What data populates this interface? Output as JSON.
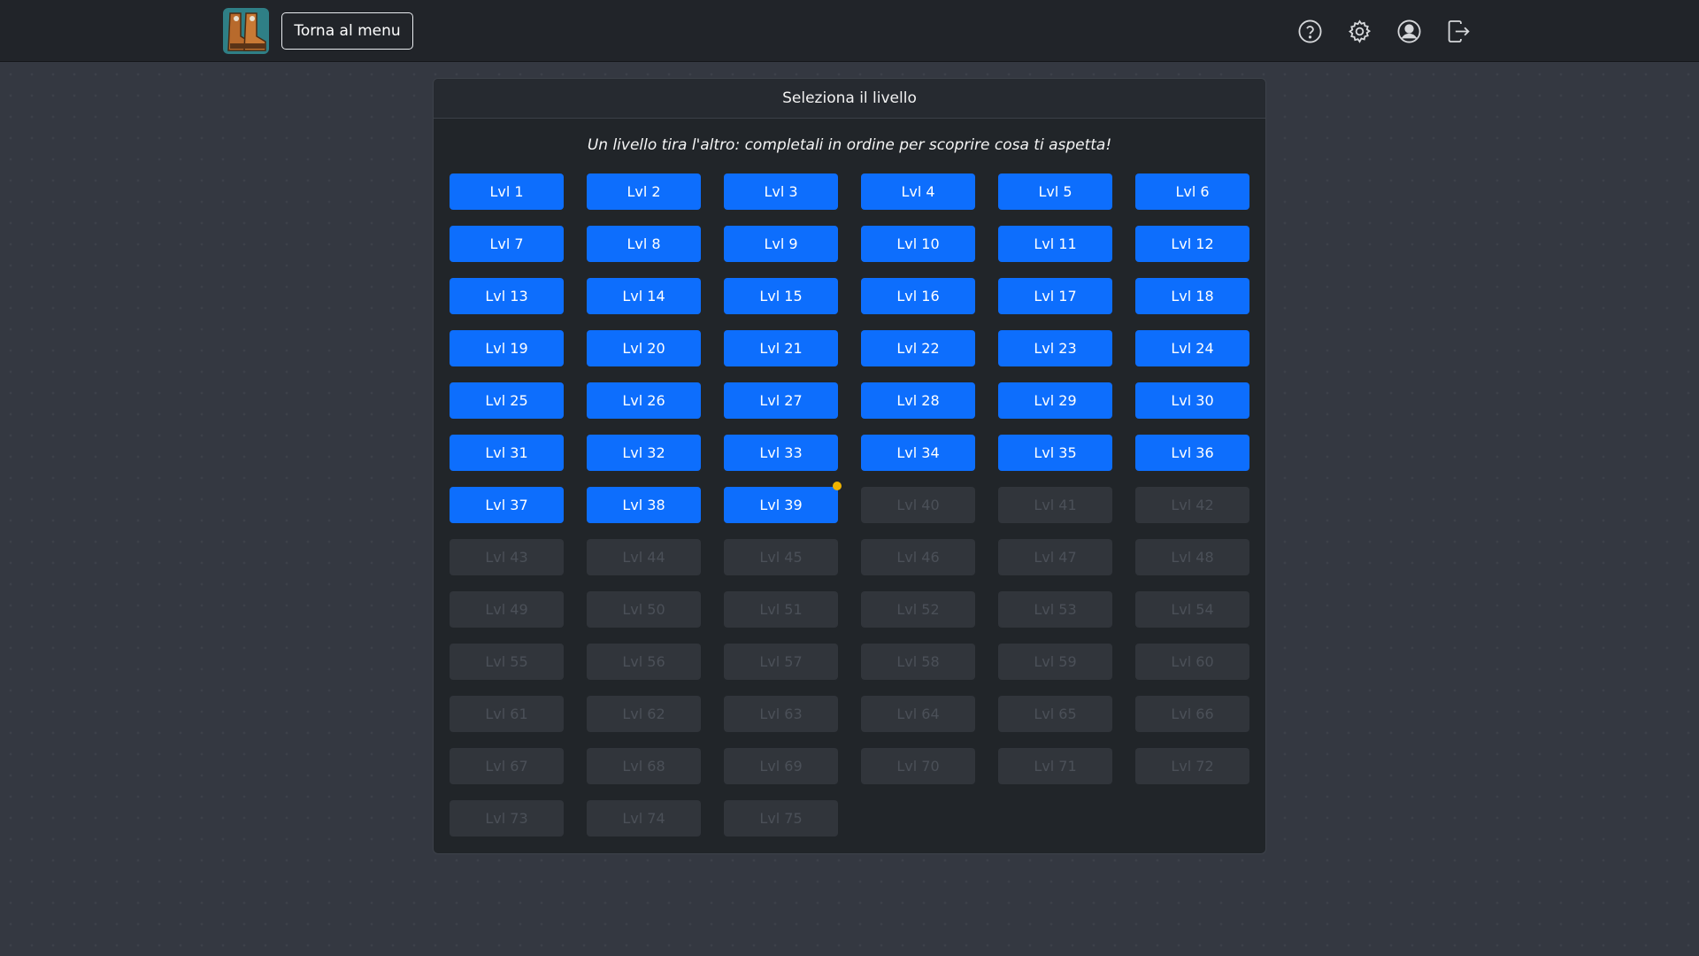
{
  "header": {
    "back_label": "Torna al menu",
    "logo": "boots-logo",
    "icons": [
      "help-icon",
      "gear-icon",
      "user-icon",
      "logout-icon"
    ]
  },
  "card": {
    "title": "Seleziona il livello",
    "subtitle": "Un livello tira l'altro: completali in ordine per scoprire cosa ti aspetta!"
  },
  "levels": {
    "prefix": "Lvl",
    "total": 75,
    "unlocked_count": 39,
    "current_level": 39
  },
  "colors": {
    "unlocked": "#0d6efd",
    "locked": "#31353b",
    "indicator": "#f0b400"
  }
}
